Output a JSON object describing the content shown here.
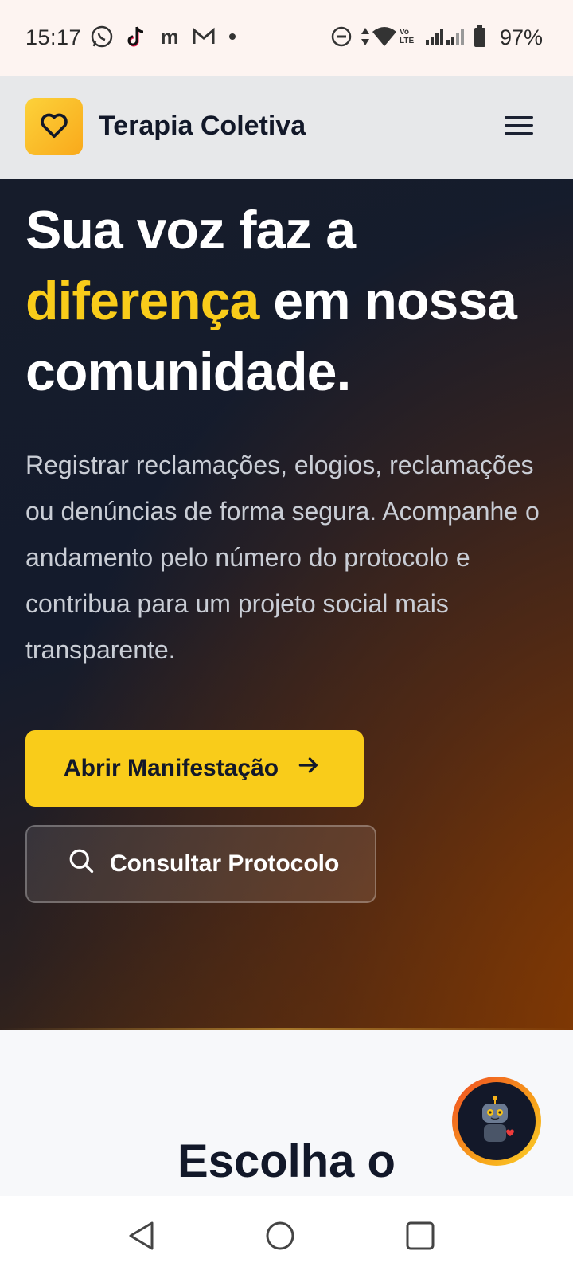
{
  "status_bar": {
    "time": "15:17",
    "notification_icons": [
      "whatsapp-icon",
      "tiktok-icon",
      "m-app-icon",
      "gmail-icon",
      "dot-icon"
    ],
    "system_icons": [
      "do-not-disturb-icon",
      "data-arrows-icon",
      "wifi-icon",
      "volte-icon",
      "signal-icon",
      "signal-icon",
      "battery-icon"
    ],
    "volte_label": "Vo LTE",
    "battery": "97%"
  },
  "header": {
    "logo_icon": "heart-icon",
    "brand": "Terapia Coletiva",
    "menu_icon": "hamburger-menu-icon"
  },
  "hero": {
    "title_line1": "Sua voz faz a",
    "title_accent": "diferença",
    "title_rest": " em nossa comunidade.",
    "description": "Registrar reclamações, elogios, reclamações ou denúncias de forma segura. Acompanhe o andamento pelo número do protocolo e contribua para um projeto social mais transparente.",
    "primary_button": "Abrir Manifestação",
    "secondary_button": "Consultar Protocolo"
  },
  "section": {
    "title": "Escolha o"
  },
  "chatbot": {
    "icon": "robot-icon"
  },
  "nav_bar": {
    "icons": [
      "back-icon",
      "home-icon",
      "recents-icon"
    ]
  },
  "colors": {
    "accent": "#f9cc1a",
    "hero_bg": "#141b2c",
    "text_dark": "#121829"
  }
}
